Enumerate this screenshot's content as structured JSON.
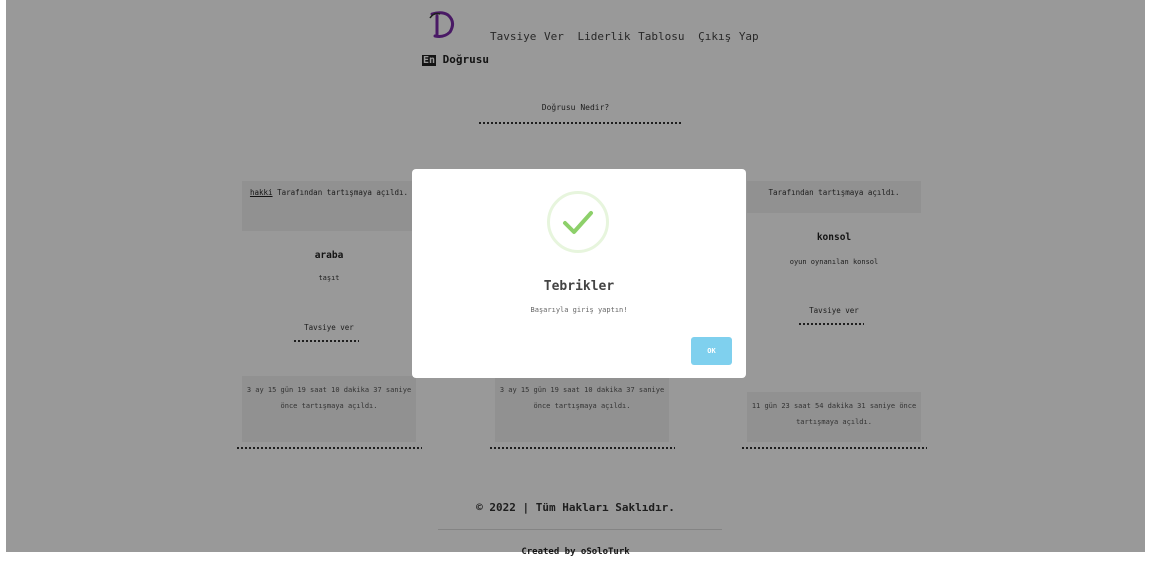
{
  "header": {
    "brand_en": "En",
    "brand_name": "Doğrusu",
    "nav": [
      "Tavsiye Ver",
      "Liderlik Tablosu",
      "Çıkış Yap"
    ],
    "accent_color": "#7b2aa8"
  },
  "hero": {
    "title": "Doğrusu Nedir?"
  },
  "cards": [
    {
      "author": "hakki",
      "opened_by": "Tarafından tartışmaya açıldı.",
      "title": "araba",
      "desc": "taşıt",
      "recommend": "Tavsiye ver",
      "age": "3 ay 15 gün 19 saat 10 dakika 37 saniye önce tartışmaya açıldı."
    },
    {
      "author": "",
      "opened_by": "",
      "title": "",
      "desc": "",
      "recommend": "",
      "age": "3 ay 15 gün 19 saat 10 dakika 37 saniye önce tartışmaya açıldı."
    },
    {
      "author": "",
      "opened_by": "Tarafından tartışmaya açıldı.",
      "title": "konsol",
      "desc": "oyun oynanılan konsol",
      "recommend": "Tavsiye ver",
      "age": "11 gün 23 saat 54 dakika 31 saniye önce tartışmaya açıldı."
    }
  ],
  "footer": {
    "copyright": "© 2022 | Tüm Hakları Saklıdır.",
    "created": "Created by oSoloTurk"
  },
  "modal": {
    "title": "Tebrikler",
    "message": "Başarıyla giriş yaptın!",
    "ok_label": "OK",
    "icon": "success-check-icon",
    "check_color": "#8dd06a",
    "button_color": "#7fd0ee"
  }
}
